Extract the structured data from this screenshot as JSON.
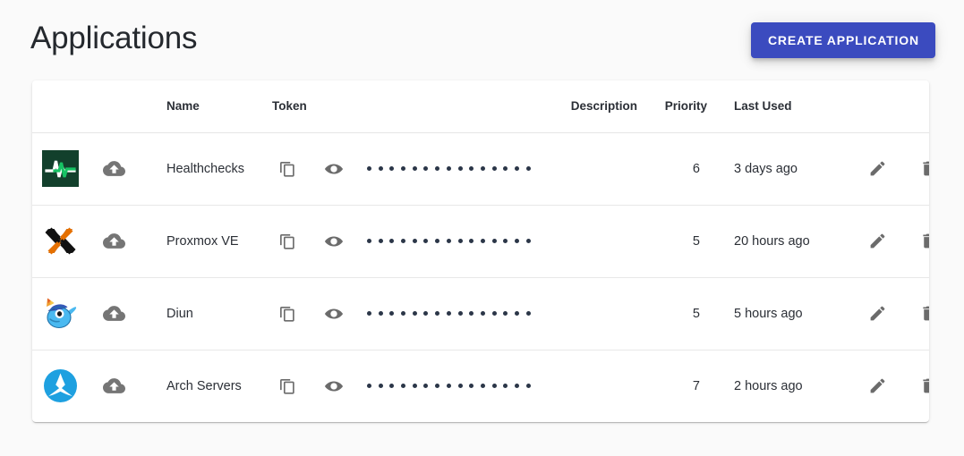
{
  "header": {
    "title": "Applications",
    "create_button_label": "CREATE APPLICATION",
    "accent_color": "#3b4bbf"
  },
  "table": {
    "columns": [
      {
        "key": "logo",
        "label": ""
      },
      {
        "key": "upload",
        "label": ""
      },
      {
        "key": "name",
        "label": "Name"
      },
      {
        "key": "token",
        "label": "Token"
      },
      {
        "key": "description",
        "label": "Description"
      },
      {
        "key": "priority",
        "label": "Priority"
      },
      {
        "key": "last_used",
        "label": "Last Used"
      },
      {
        "key": "edit",
        "label": ""
      },
      {
        "key": "delete",
        "label": ""
      }
    ],
    "token_mask_dot_count": 15,
    "rows": [
      {
        "logo": "healthchecks-logo",
        "upload_icon": "cloud-upload-icon",
        "name": "Healthchecks",
        "copy_icon": "copy-icon",
        "reveal_icon": "eye-icon",
        "token": "•••••••••••••••",
        "description": "",
        "priority": "6",
        "last_used": "3 days ago",
        "edit_icon": "pencil-icon",
        "delete_icon": "trash-icon"
      },
      {
        "logo": "proxmox-logo",
        "upload_icon": "cloud-upload-icon",
        "name": "Proxmox VE",
        "copy_icon": "copy-icon",
        "reveal_icon": "eye-icon",
        "token": "•••••••••••••••",
        "description": "",
        "priority": "5",
        "last_used": "20 hours ago",
        "edit_icon": "pencil-icon",
        "delete_icon": "trash-icon"
      },
      {
        "logo": "diun-logo",
        "upload_icon": "cloud-upload-icon",
        "name": "Diun",
        "copy_icon": "copy-icon",
        "reveal_icon": "eye-icon",
        "token": "•••••••••••••••",
        "description": "",
        "priority": "5",
        "last_used": "5 hours ago",
        "edit_icon": "pencil-icon",
        "delete_icon": "trash-icon"
      },
      {
        "logo": "arch-linux-logo",
        "upload_icon": "cloud-upload-icon",
        "name": "Arch Servers",
        "copy_icon": "copy-icon",
        "reveal_icon": "eye-icon",
        "token": "•••••••••••••••",
        "description": "",
        "priority": "7",
        "last_used": "2 hours ago",
        "edit_icon": "pencil-icon",
        "delete_icon": "trash-icon"
      }
    ]
  }
}
